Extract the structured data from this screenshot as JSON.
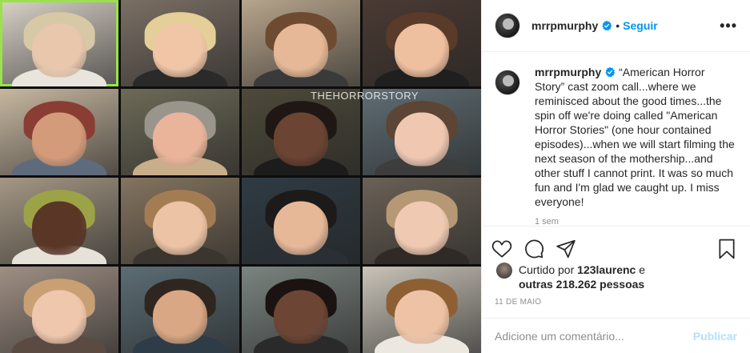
{
  "post": {
    "watermark": "THEHORRORSTORY",
    "tiles": [
      {
        "bg": "#d9d3c8",
        "hair": "#d8c9a6",
        "face": "#e8c7ad",
        "shirt": "#e9e4dc",
        "active": true
      },
      {
        "bg": "#7a6f64",
        "hair": "#e4cf98",
        "face": "#f0c6a6",
        "shirt": "#2a2a2a",
        "active": false
      },
      {
        "bg": "#b7a58c",
        "hair": "#6e4a30",
        "face": "#e6b897",
        "shirt": "#3a3a3a",
        "active": false
      },
      {
        "bg": "#4a3a33",
        "hair": "#5a3a28",
        "face": "#efc0a0",
        "shirt": "#1f1f1f",
        "active": false
      },
      {
        "bg": "#c7b7a0",
        "hair": "#8a3d33",
        "face": "#d49b7a",
        "shirt": "#5e6b7c",
        "active": false
      },
      {
        "bg": "#6d6a57",
        "hair": "#9a958c",
        "face": "#e9b49a",
        "shirt": "#c9ae8b",
        "active": false
      },
      {
        "bg": "#4e4a3a",
        "hair": "#1f1714",
        "face": "#6b4433",
        "shirt": "#1c1c1c",
        "active": false
      },
      {
        "bg": "#5f6d73",
        "hair": "#5c4534",
        "face": "#f0c8b2",
        "shirt": "#3d3d3d",
        "active": false
      },
      {
        "bg": "#a49784",
        "hair": "#9ca347",
        "face": "#5a3627",
        "shirt": "#e6e2d8",
        "active": false
      },
      {
        "bg": "#84745f",
        "hair": "#a47c54",
        "face": "#ecc3a4",
        "shirt": "#3b3530",
        "active": false
      },
      {
        "bg": "#2f3b44",
        "hair": "#1d1a1a",
        "face": "#e7b898",
        "shirt": "#2a2f35",
        "active": false
      },
      {
        "bg": "#6a6156",
        "hair": "#b69874",
        "face": "#efc9b1",
        "shirt": "#2f2a26",
        "active": false
      },
      {
        "bg": "#9f8f84",
        "hair": "#c8a074",
        "face": "#efc7ad",
        "shirt": "#5b4a42",
        "active": false
      },
      {
        "bg": "#5b6d74",
        "hair": "#2f2620",
        "face": "#d9a783",
        "shirt": "#2d3c47",
        "active": false
      },
      {
        "bg": "#7b8480",
        "hair": "#1b1311",
        "face": "#6c4535",
        "shirt": "#2a2a2a",
        "active": false
      },
      {
        "bg": "#c9c3b8",
        "hair": "#8d5f33",
        "face": "#eec3a5",
        "shirt": "#ece8e0",
        "active": false
      }
    ]
  },
  "header": {
    "username": "mrrpmurphy",
    "separator": "•",
    "follow_label": "Seguir",
    "more_label": "•••"
  },
  "caption": {
    "username": "mrrpmurphy",
    "text": " “American Horror Story” cast zoom call...where we reminisced about the good times...the spin off we're doing called \"American Horror Stories\" (one hour contained episodes)...when we will start filming the next season of the mothership...and other stuff I cannot print. It was so much fun and I'm glad we caught up. I miss everyone!",
    "time": "1 sem"
  },
  "likes": {
    "prefix": "Curtido por ",
    "liker": "123laurenc",
    "conjunction": " e",
    "others": "outras 218.262 pessoas"
  },
  "date": "11 DE MAIO",
  "comment_box": {
    "placeholder": "Adicione um comentário...",
    "publish_label": "Publicar"
  },
  "colors": {
    "accent": "#0095f6",
    "publish_disabled": "#b2dffc",
    "active_speaker": "#9be24a"
  },
  "icons": [
    "verified-badge-icon",
    "heart-icon",
    "comment-icon",
    "share-icon",
    "bookmark-icon",
    "more-icon"
  ]
}
